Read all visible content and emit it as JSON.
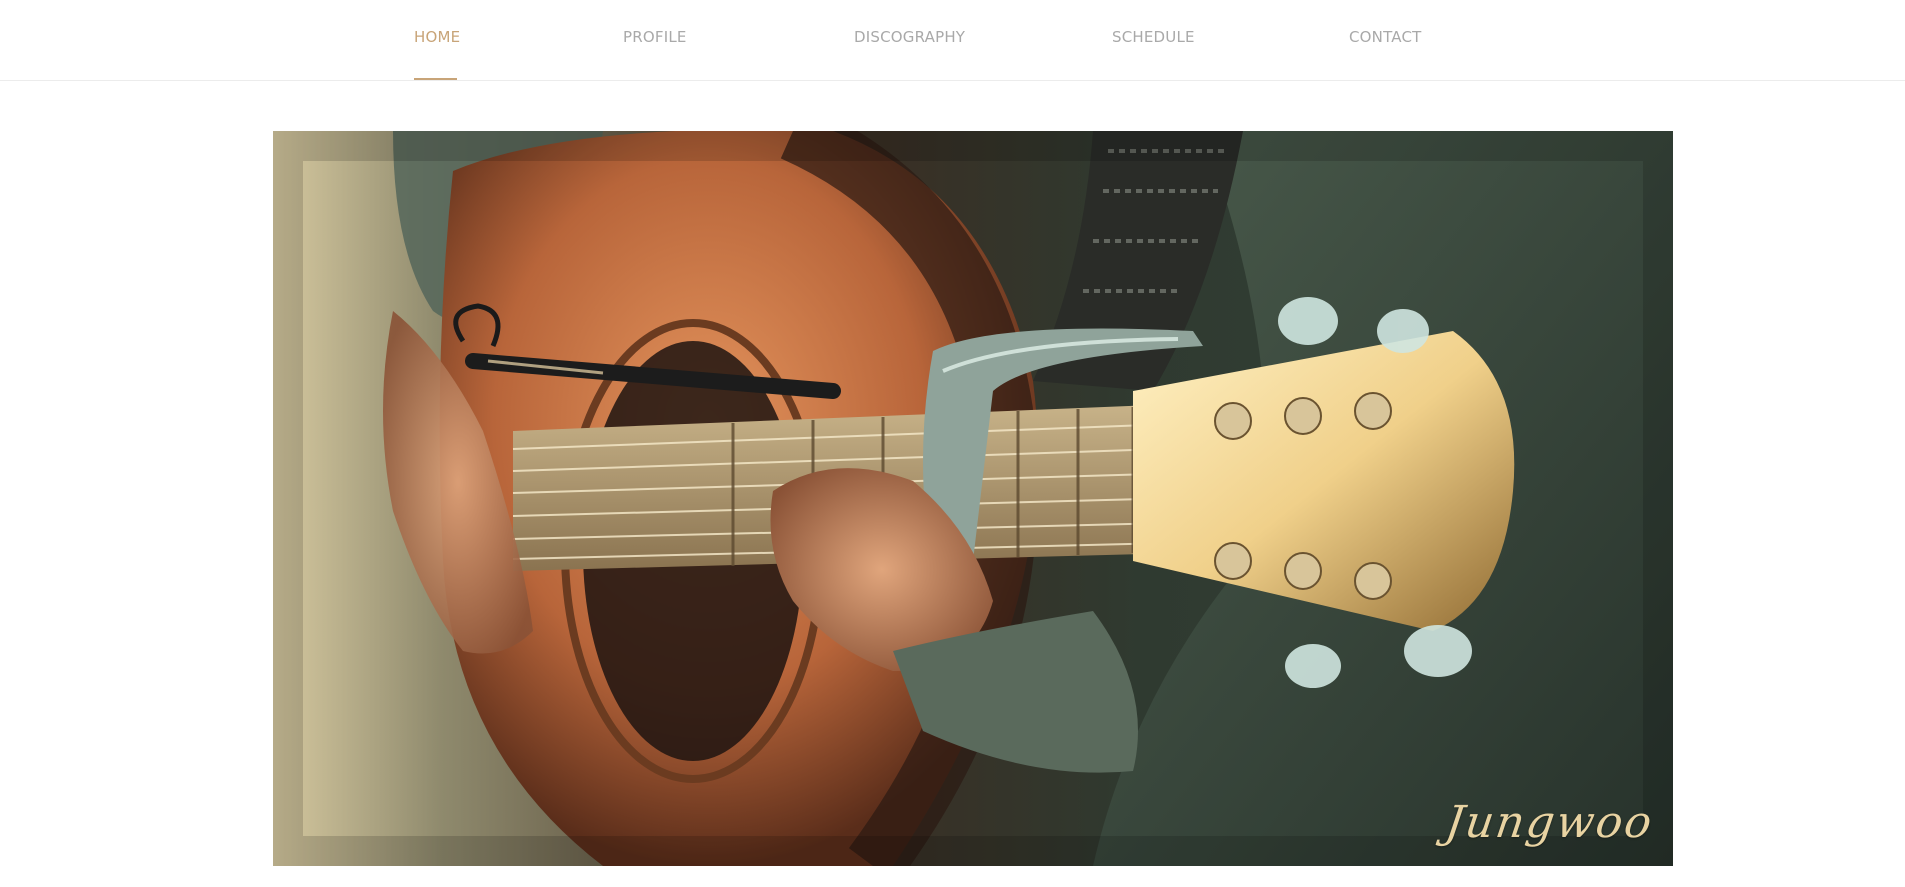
{
  "nav": {
    "items": [
      {
        "label": "HOME",
        "active": true
      },
      {
        "label": "PROFILE",
        "active": false
      },
      {
        "label": "DISCOGRAPHY",
        "active": false
      },
      {
        "label": "SCHEDULE",
        "active": false
      },
      {
        "label": "CONTACT",
        "active": false
      }
    ]
  },
  "hero": {
    "image_subject": "close-up of a person playing an acoustic guitar with a capo",
    "signature": "Jungwoo"
  },
  "colors": {
    "accent": "#c8a478",
    "nav_text": "#a9a9a9",
    "signature": "#e8d3a2"
  }
}
